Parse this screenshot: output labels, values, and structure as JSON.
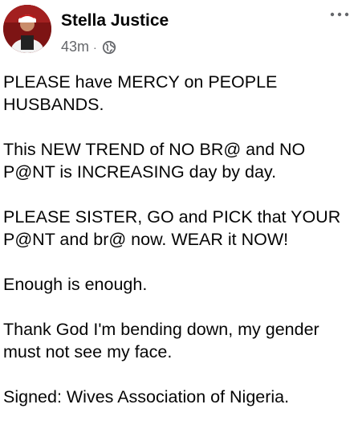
{
  "post": {
    "author": "Stella Justice",
    "time": "43m",
    "separator": "·",
    "privacy_icon": "globe-icon",
    "more_icon": "more-options-icon",
    "paragraphs": [
      "PLEASE have MERCY on PEOPLE\nHUSBANDS.",
      "This NEW TREND of NO BR@ and NO\nP@NT is INCREASING day by day.",
      "PLEASE SISTER, GO and PICK that YOUR\nP@NT and br@ now.  WEAR it NOW!",
      "Enough is enough.",
      "Thank God I'm bending down, my gender\nmust not see my face.",
      "Signed: Wives Association of Nigeria."
    ]
  },
  "colors": {
    "text": "#050505",
    "secondary": "#65676b",
    "avatar_bg": "#8a1a1a"
  }
}
